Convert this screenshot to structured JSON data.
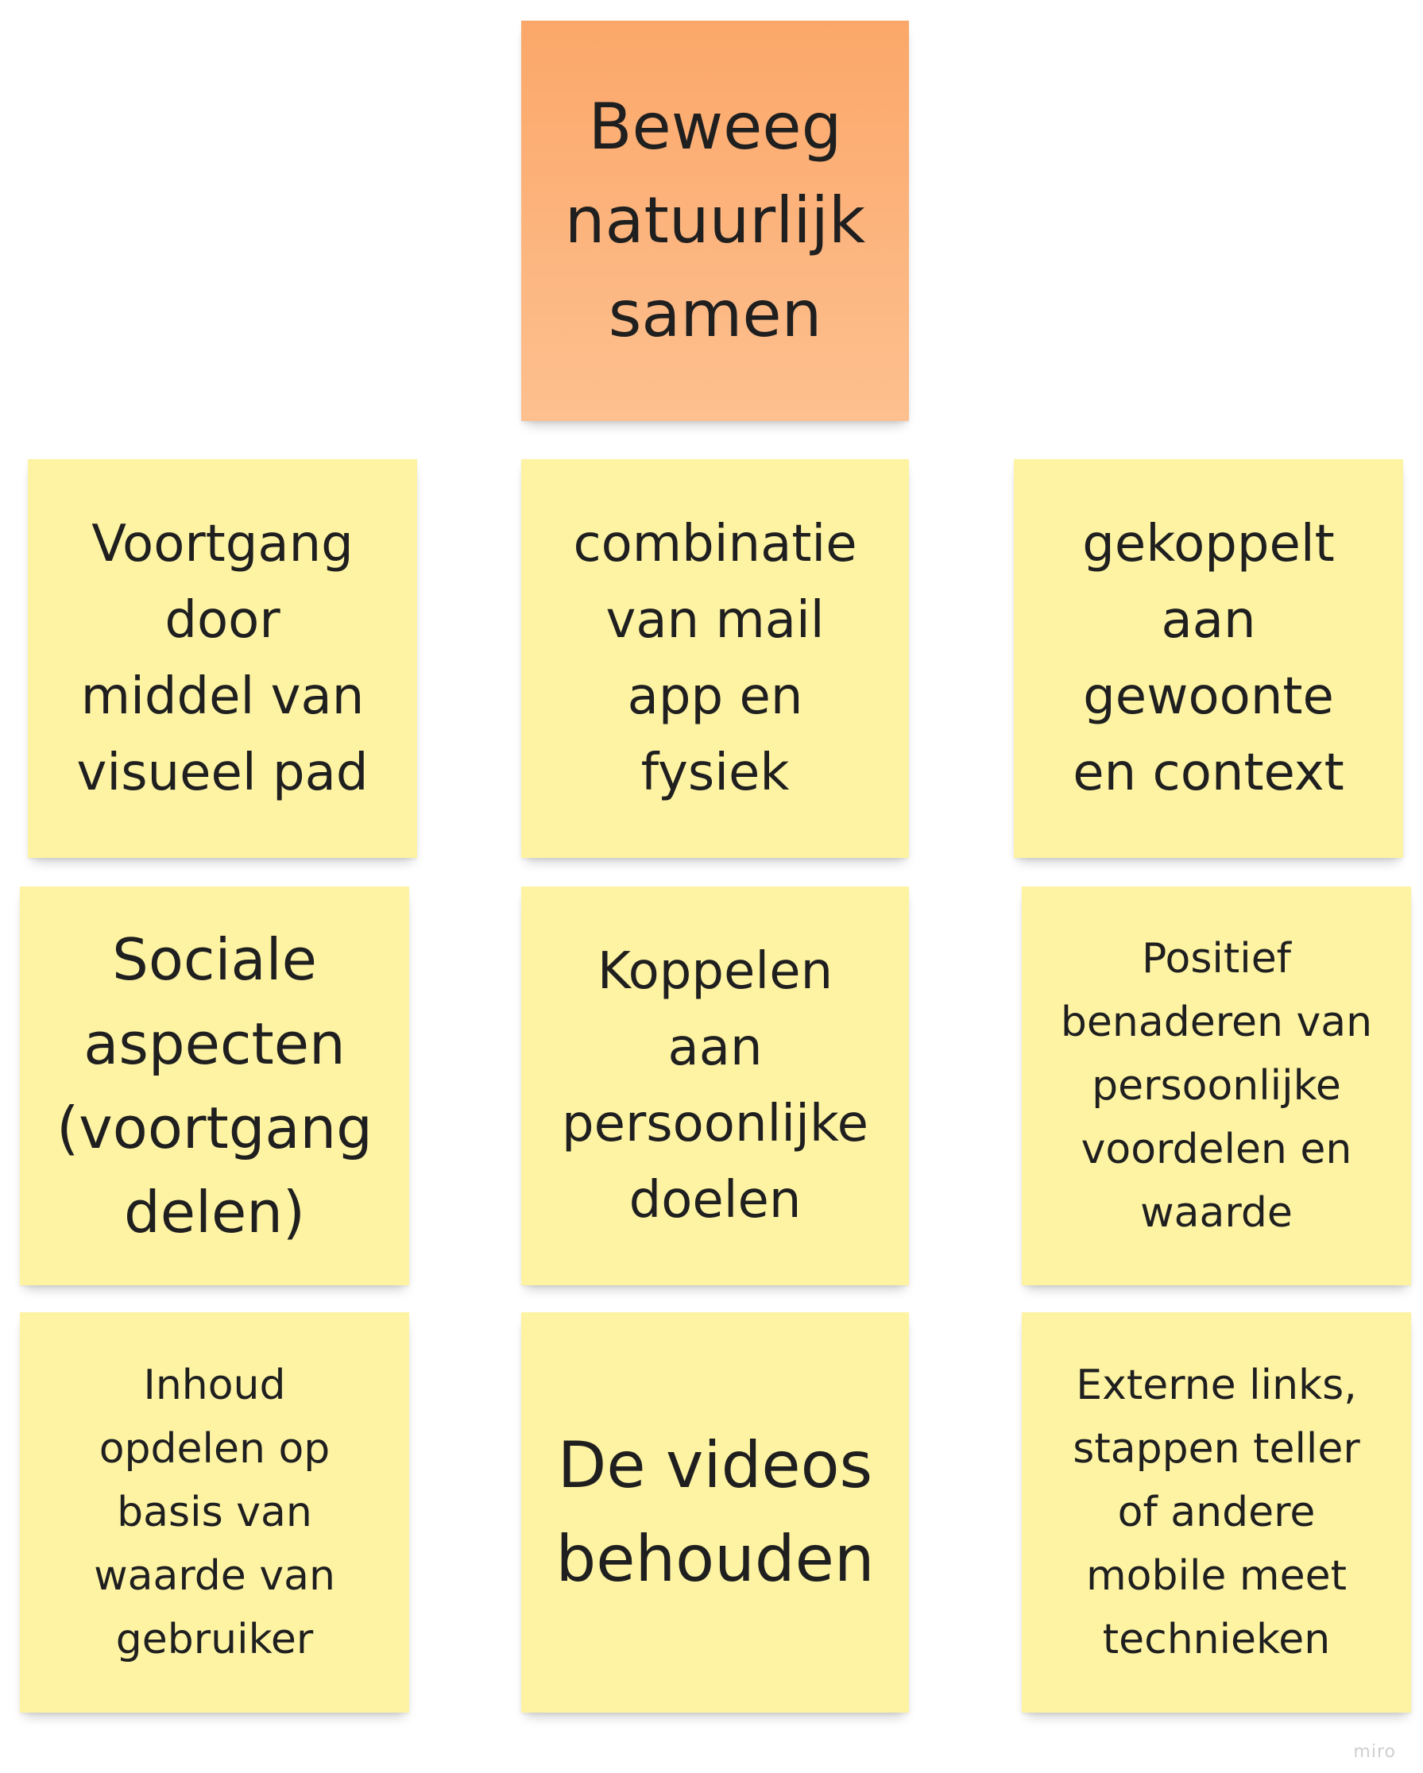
{
  "board": {
    "title_note": {
      "text": "Beweeg\nnatuurlijk\nsamen",
      "color": "#fbab6e"
    },
    "notes_color": "#fdf3a3",
    "notes": [
      "Voortgang\ndoor\nmiddel van\nvisueel pad",
      "combinatie\nvan mail\napp en\nfysiek",
      "gekoppelt\naan\ngewoonte\nen context",
      "Sociale\naspecten\n(voortgang\ndelen)",
      "Koppelen\naan\npersoonlijke\ndoelen",
      "Positief\nbenaderen van\npersoonlijke\nvoordelen en\nwaarde",
      "Inhoud\nopdelen op\nbasis van\nwaarde van\ngebruiker",
      "De videos\nbehouden",
      "Externe links,\nstappen teller\nof andere\nmobile meet\ntechnieken"
    ],
    "watermark": "miro"
  }
}
